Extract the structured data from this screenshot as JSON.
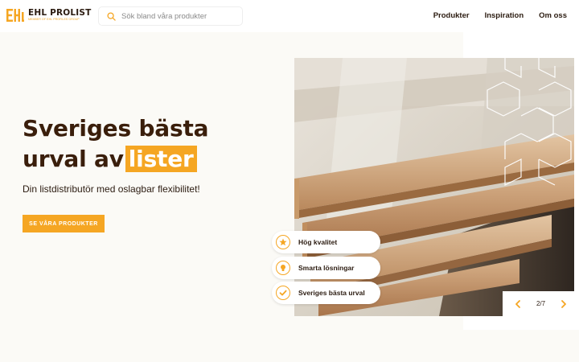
{
  "brand": {
    "name": "EHL PROLIST",
    "tagline": "MEMBER OF EHL PROFILES GROUP",
    "accent": "#f5a623",
    "dark": "#3a1e0b"
  },
  "search": {
    "placeholder": "Sök bland våra produkter"
  },
  "nav": {
    "items": [
      "Produkter",
      "Inspiration",
      "Om oss"
    ]
  },
  "hero": {
    "title_line1": "Sveriges bästa",
    "title_line2_prefix": "urval av",
    "title_highlight": "lister",
    "subtitle": "Din listdistributör med oslagbar flexibilitet!",
    "cta_label": "SE VÅRA PRODUKTER"
  },
  "features": [
    {
      "label": "Hög kvalitet",
      "icon": "star-icon"
    },
    {
      "label": "Smarta lösningar",
      "icon": "lightbulb-icon"
    },
    {
      "label": "Sveriges bästa urval",
      "icon": "check-icon"
    }
  ],
  "slider": {
    "counter": "2/7",
    "current": 2,
    "total": 7
  }
}
